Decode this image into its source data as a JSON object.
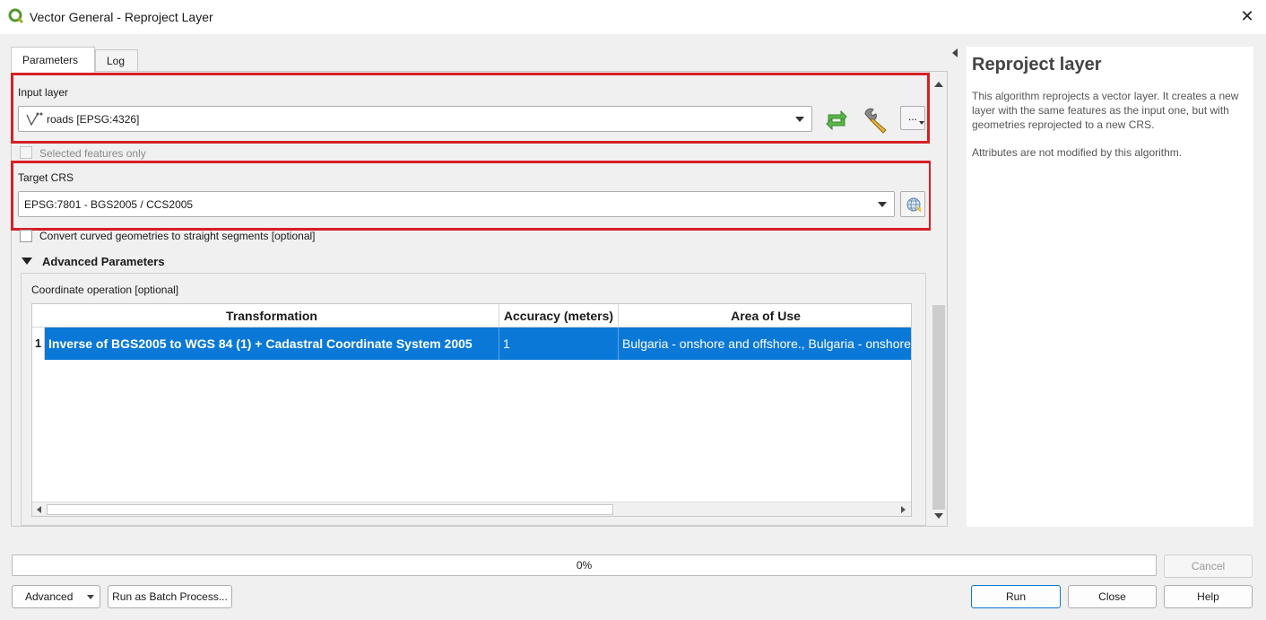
{
  "window": {
    "title": "Vector General - Reproject Layer",
    "close_glyph": "✕"
  },
  "tabs": [
    {
      "label": "Parameters",
      "active": true
    },
    {
      "label": "Log",
      "active": false
    }
  ],
  "input_layer": {
    "label": "Input layer",
    "value": "roads [EPSG:4326]",
    "selected_only_label": "Selected features only",
    "more_label": "..."
  },
  "target_crs": {
    "label": "Target CRS",
    "value": "EPSG:7801 - BGS2005 / CCS2005"
  },
  "convert_curves": {
    "label": "Convert curved geometries to straight segments [optional]"
  },
  "advanced": {
    "header": "Advanced Parameters",
    "coord_op_label": "Coordinate operation [optional]"
  },
  "table": {
    "columns": [
      "Transformation",
      "Accuracy (meters)",
      "Area of Use"
    ],
    "rows": [
      {
        "index": "1",
        "transformation": "Inverse of BGS2005 to WGS 84 (1) + Cadastral Coordinate System 2005",
        "accuracy": "1",
        "area": "Bulgaria - onshore and offshore., Bulgaria - onshore"
      }
    ]
  },
  "help": {
    "title": "Reproject layer",
    "paragraph1": "This algorithm reprojects a vector layer. It creates a new layer with the same features as the input one, but with geometries reprojected to a new CRS.",
    "paragraph2": "Attributes are not modified by this algorithm."
  },
  "progress": {
    "text": "0%",
    "value": 0
  },
  "buttons": {
    "cancel": "Cancel",
    "advanced": "Advanced",
    "batch": "Run as Batch Process...",
    "run": "Run",
    "close": "Close",
    "help": "Help"
  },
  "colors": {
    "highlight": "#d52026",
    "selection": "#0a78d7"
  }
}
